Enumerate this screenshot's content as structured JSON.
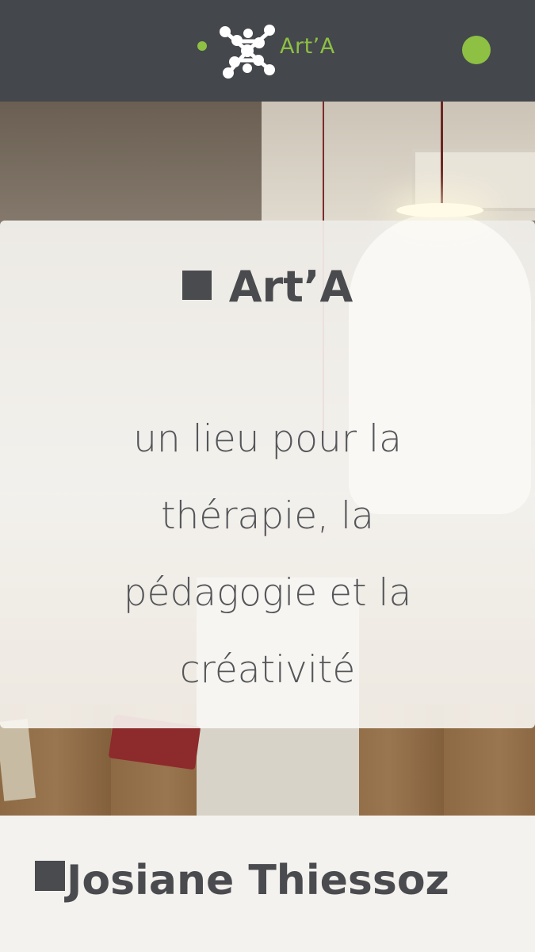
{
  "header": {
    "logo_text": "Art’A",
    "logo_icon": "molecule-logo-icon",
    "menu_icon": "menu-dot-icon",
    "accent_color": "#8dc043",
    "bar_color": "#44474c"
  },
  "hero": {
    "title": "Art’A",
    "subtitle": "un lieu pour la thérapie, la pédagogie et la créativité",
    "background_icon": "interior-photo"
  },
  "section2": {
    "title": "Josiane Thiessoz"
  }
}
